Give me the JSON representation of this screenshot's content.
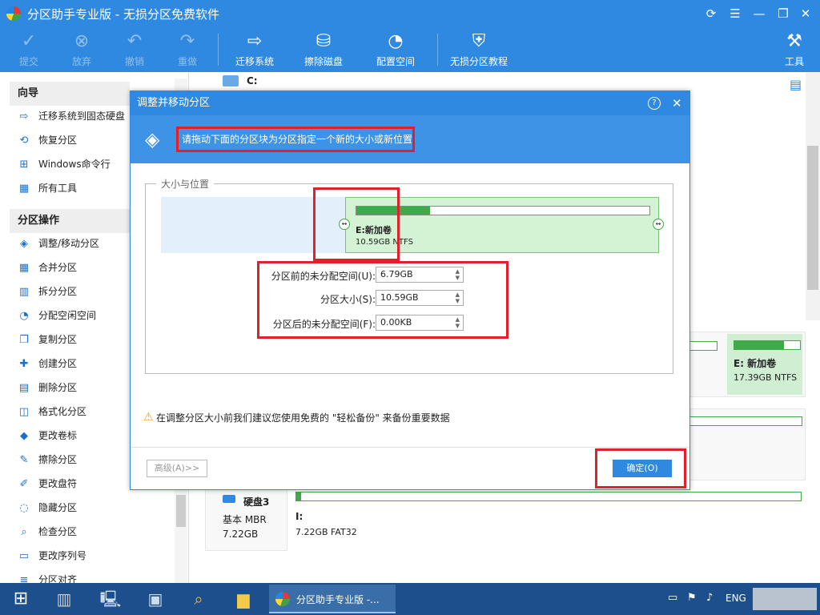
{
  "window": {
    "title": "分区助手专业版 - 无损分区免费软件",
    "controls": [
      "refresh-icon",
      "menu-icon",
      "restore-icon",
      "close-icon"
    ]
  },
  "toolbar": {
    "buttons": [
      {
        "label": "提交",
        "icon": "check-icon",
        "enabled": false
      },
      {
        "label": "放弃",
        "icon": "discard-icon",
        "enabled": false
      },
      {
        "label": "撤销",
        "icon": "undo-icon",
        "enabled": false
      },
      {
        "label": "重做",
        "icon": "redo-icon",
        "enabled": false
      },
      {
        "label": "迁移系统",
        "icon": "migrate-icon",
        "enabled": true
      },
      {
        "label": "擦除磁盘",
        "icon": "wipe-disk-icon",
        "enabled": true
      },
      {
        "label": "配置空间",
        "icon": "pie-icon",
        "enabled": true
      },
      {
        "label": "无损分区教程",
        "icon": "shield-icon",
        "enabled": true
      },
      {
        "label": "工具",
        "icon": "tools-icon",
        "enabled": true
      }
    ]
  },
  "sidebar": {
    "wizard_header": "向导",
    "wizard_items": [
      "迁移系统到固态硬盘",
      "恢复分区",
      "Windows命令行",
      "所有工具"
    ],
    "ops_header": "分区操作",
    "ops_items": [
      "调整/移动分区",
      "合并分区",
      "拆分分区",
      "分配空闲空间",
      "复制分区",
      "创建分区",
      "删除分区",
      "格式化分区",
      "更改卷标",
      "擦除分区",
      "更改盘符",
      "隐藏分区",
      "检查分区",
      "更改序列号",
      "分区对齐"
    ]
  },
  "main": {
    "c_label": "C:",
    "e_card": {
      "name": "E: 新加卷",
      "info": "17.39GB NTFS",
      "fill": 0.75
    },
    "disk3": {
      "name": "硬盘3",
      "type": "基本 MBR",
      "size": "7.22GB",
      "part_label": "I:",
      "part_info": "7.22GB FAT32",
      "fill": 0.01
    }
  },
  "dialog": {
    "title": "调整并移动分区",
    "banner_text": "请拖动下面的分区块为分区指定一个新的大小或新位置",
    "group_title": "大小与位置",
    "partition": {
      "name": "E:新加卷",
      "info": "10.59GB NTFS",
      "used_fill": 0.25
    },
    "fields": [
      {
        "label": "分区前的未分配空间(U):",
        "value": "6.79GB"
      },
      {
        "label": "分区大小(S):",
        "value": "10.59GB"
      },
      {
        "label": "分区后的未分配空间(F):",
        "value": "0.00KB"
      }
    ],
    "warning": "在调整分区大小前我们建议您使用免费的 \"轻松备份\" 来备份重要数据",
    "advanced_label": "高级(A)>>",
    "ok_label": "确定(O)"
  },
  "taskbar": {
    "active_app": "分区助手专业版 -...",
    "lang": "ENG"
  }
}
